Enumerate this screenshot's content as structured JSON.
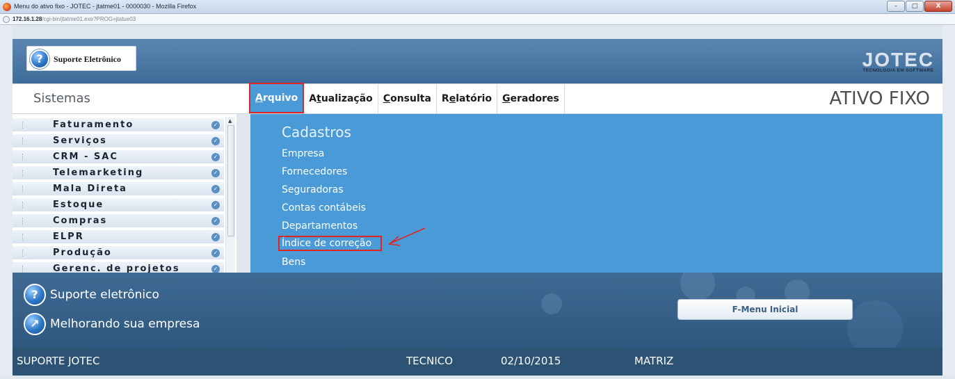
{
  "window": {
    "title": "Menu do ativo fixo - JOTEC - jtatme01 - 0000030 - Mozilla Firefox",
    "url_host": "172.16.1.28",
    "url_path": "/cgi-bin/jtatme01.exe?PROG=jtatue03",
    "controls": {
      "minimize": "–",
      "maximize": "□",
      "close": "X"
    }
  },
  "header": {
    "support_logo_text": "Suporte Eletrônico",
    "brand": "JOTEC",
    "brand_tagline": "TECNOLOGIA EM SOFTWARE"
  },
  "menubar": {
    "sistemas_label": "Sistemas",
    "module_title": "ATIVO FIXO",
    "items": [
      {
        "key": "A",
        "rest": "rquivo",
        "label": "Arquivo",
        "active": true
      },
      {
        "key": "A",
        "rest": "tualização",
        "label": "Atualização",
        "active": false
      },
      {
        "key": "C",
        "rest": "onsulta",
        "label": "Consulta",
        "active": false
      },
      {
        "key": "R",
        "pre": "",
        "mid": "e",
        "label": "Relatório",
        "active": false
      },
      {
        "key": "G",
        "rest": "eradores",
        "label": "Geradores",
        "active": false
      }
    ]
  },
  "sidebar": {
    "items": [
      {
        "label": "Faturamento"
      },
      {
        "label": "Serviços"
      },
      {
        "label": "CRM - SAC"
      },
      {
        "label": "Telemarketing"
      },
      {
        "label": "Mala Direta"
      },
      {
        "label": "Estoque"
      },
      {
        "label": "Compras"
      },
      {
        "label": "ELPR"
      },
      {
        "label": "Produção"
      },
      {
        "label": "Gerenc. de projetos"
      }
    ],
    "check_icon": "check-circle-icon"
  },
  "content": {
    "heading": "Cadastros",
    "links": [
      {
        "label": "Empresa",
        "highlighted": false
      },
      {
        "label": "Fornecedores",
        "highlighted": false
      },
      {
        "label": "Seguradoras",
        "highlighted": false
      },
      {
        "label": "Contas contábeis",
        "highlighted": false
      },
      {
        "label": "Departamentos",
        "highlighted": false
      },
      {
        "label": "Índice de correção",
        "highlighted": true
      },
      {
        "label": "Bens",
        "highlighted": false
      }
    ]
  },
  "footer": {
    "support_text": "Suporte eletrônico",
    "improving_text": "Melhorando sua empresa",
    "fmenu_button": "F-Menu Inicial"
  },
  "statusbar": {
    "company": "SUPORTE JOTEC",
    "user": "TECNICO",
    "date": "02/10/2015",
    "branch": "MATRIZ"
  },
  "colors": {
    "header_blue": "#3e6b99",
    "content_blue": "#4a9ad8",
    "highlight_red": "#e02424",
    "status_bar": "#2c5274"
  }
}
